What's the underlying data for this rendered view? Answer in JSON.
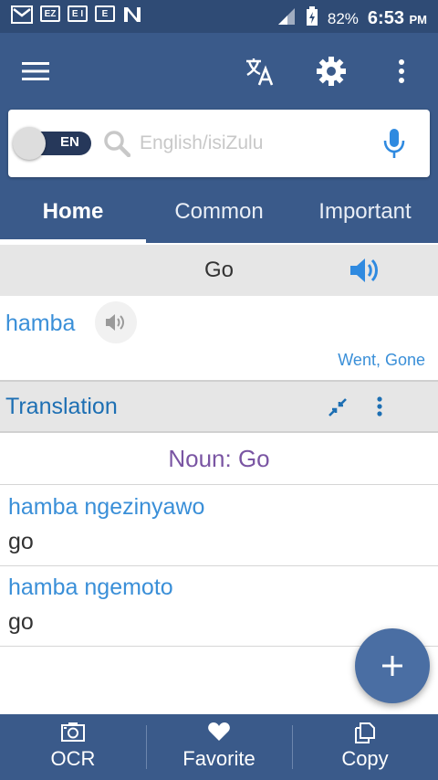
{
  "status_bar": {
    "notif_icons": [
      "EZ",
      "E I",
      "E"
    ],
    "battery": "82%",
    "time": "6:53",
    "ampm": "PM"
  },
  "toolbar": {
    "menu_icon": "hamburger-icon",
    "translate_icon": "translate-icon",
    "settings_icon": "gear-icon",
    "more_icon": "more-vert-icon"
  },
  "search": {
    "toggle_label": "EN",
    "placeholder": "English/isiZulu",
    "value": ""
  },
  "tabs": [
    {
      "label": "Home",
      "active": true
    },
    {
      "label": "Common",
      "active": false
    },
    {
      "label": "Important",
      "active": false
    }
  ],
  "lookup": {
    "word": "Go",
    "translation": "hamba",
    "alternatives": "Went, Gone"
  },
  "section": {
    "title": "Translation"
  },
  "part_of_speech": "Noun: Go",
  "entries": [
    {
      "word": "hamba ngezinyawo",
      "meaning": "go"
    },
    {
      "word": "hamba ngemoto",
      "meaning": "go"
    }
  ],
  "bottom_nav": [
    {
      "label": "OCR",
      "icon": "camera-icon"
    },
    {
      "label": "Favorite",
      "icon": "heart-icon"
    },
    {
      "label": "Copy",
      "icon": "copy-icon"
    }
  ],
  "colors": {
    "primary": "#3a5a8a",
    "status_bar": "#2f4b75",
    "accent_blue": "#3a8fd8",
    "pos_purple": "#7a55a3"
  }
}
